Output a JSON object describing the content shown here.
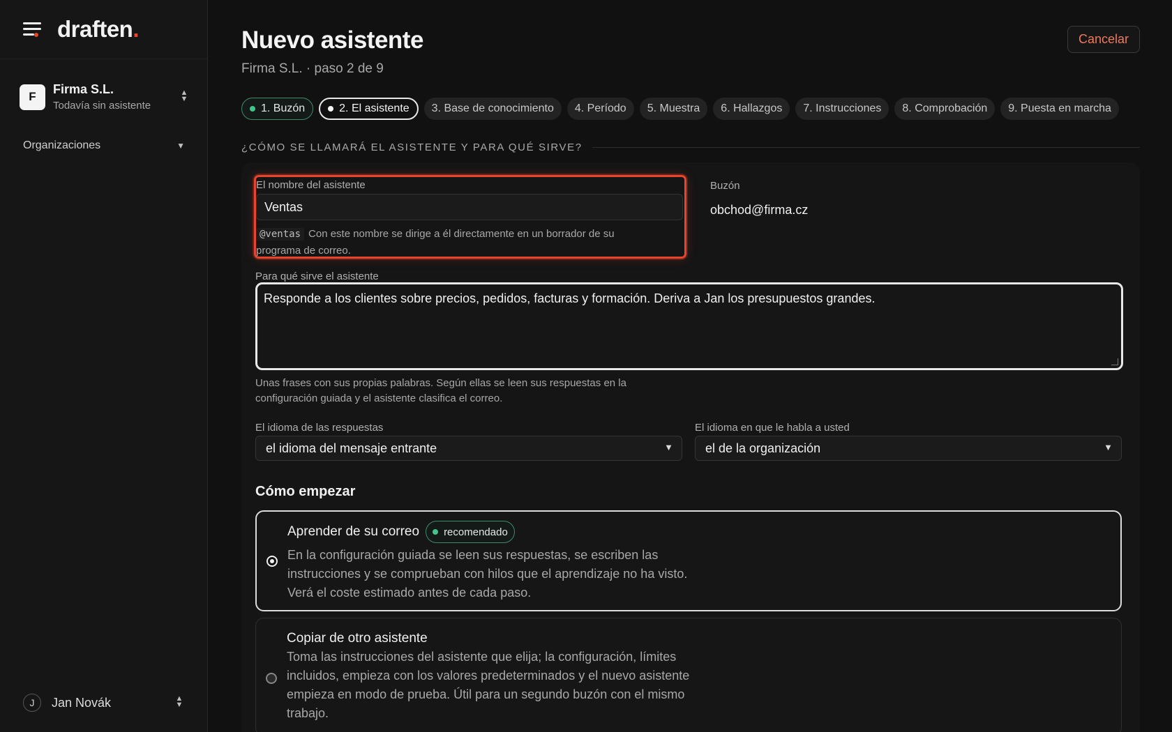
{
  "app": {
    "logo_text": "draften",
    "logo_dot": "."
  },
  "sidebar": {
    "org": {
      "initial": "F",
      "name": "Firma S.L.",
      "subtitle": "Todavía sin asistente"
    },
    "nav_section": "Organizaciones",
    "user": {
      "initial": "J",
      "name": "Jan Novák"
    }
  },
  "header": {
    "title": "Nuevo asistente",
    "subtitle": "Firma S.L. · paso 2 de 9",
    "cancel_label": "Cancelar"
  },
  "steps": [
    {
      "label": "1. Buzón",
      "state": "done"
    },
    {
      "label": "2. El asistente",
      "state": "current"
    },
    {
      "label": "3. Base de conocimiento",
      "state": "pending"
    },
    {
      "label": "4. Período",
      "state": "pending"
    },
    {
      "label": "5. Muestra",
      "state": "pending"
    },
    {
      "label": "6. Hallazgos",
      "state": "pending"
    },
    {
      "label": "7. Instrucciones",
      "state": "pending"
    },
    {
      "label": "8. Comprobación",
      "state": "pending"
    },
    {
      "label": "9. Puesta en marcha",
      "state": "pending"
    }
  ],
  "section": {
    "heading": "¿CÓMO SE LLAMARÁ EL ASISTENTE Y PARA QUÉ SIRVE?"
  },
  "form": {
    "name_label": "El nombre del asistente",
    "name_value": "Ventas",
    "handle": "@ventas",
    "handle_help": "Con este nombre se dirige a él directamente en un borrador de su programa de correo.",
    "mailbox_label": "Buzón",
    "mailbox_value": "obchod@firma.cz",
    "purpose_label": "Para qué sirve el asistente",
    "purpose_value": "Responde a los clientes sobre precios, pedidos, facturas y formación. Deriva a Jan los presupuestos grandes.",
    "purpose_help": "Unas frases con sus propias palabras. Según ellas se leen sus respuestas en la configuración guiada y el asistente clasifica el correo.",
    "reply_lang_label": "El idioma de las respuestas",
    "reply_lang_value": "el idioma del mensaje entrante",
    "ui_lang_label": "El idioma en que le habla a usted",
    "ui_lang_value": "el de la organización"
  },
  "start": {
    "title": "Cómo empezar",
    "options": [
      {
        "title": "Aprender de su correo",
        "badge": "recomendado",
        "desc": "En la configuración guiada se leen sus respuestas, se escriben las instrucciones y se comprueban con hilos que el aprendizaje no ha visto. Verá el coste estimado antes de cada paso.",
        "selected": true
      },
      {
        "title": "Copiar de otro asistente",
        "desc": "Toma las instrucciones del asistente que elija; la configuración, límites incluidos, empieza con los valores predeterminados y el nuevo asistente empieza en modo de prueba. Útil para un segundo buzón con el mismo trabajo.",
        "selected": false
      }
    ]
  },
  "colors": {
    "accent": "#e8452c",
    "success": "#44c38b",
    "background": "#111111"
  }
}
